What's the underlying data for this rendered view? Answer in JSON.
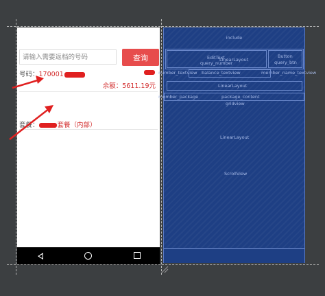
{
  "colors": {
    "accent": "#e74c4c",
    "value_red": "#d22d2d",
    "blueprint_bg": "#1e3f84",
    "canvas_bg": "#3c3f41"
  },
  "phone": {
    "search": {
      "placeholder": "请输入需要返档的号码",
      "query_button": "查询"
    },
    "number_row": {
      "label": "号码：",
      "value": "170001"
    },
    "balance_row": {
      "text": "余额：5611.19元"
    },
    "package_row": {
      "label": "套餐：",
      "value": "套餐（内部）"
    },
    "navbar": {
      "back_icon": "triangle-back-icon",
      "home_icon": "circle-home-icon",
      "recent_icon": "square-recent-icon"
    }
  },
  "blueprint": {
    "include": "include",
    "linear_layout_top": "LinearLayout",
    "edit_text": "EditText",
    "edit_text_id": "query_number",
    "button": "Button",
    "button_id": "query_btn",
    "number_textview": "number_textview",
    "balance_textview": "balance_textview",
    "member_name_textview": "member_name_textview",
    "member_package": "member_package",
    "package_content": "package_content",
    "gridview": "gridview",
    "linear_layout_mid": "LinearLayout",
    "linear_layout_main": "LinearLayout",
    "scroll_view": "ScrollView"
  }
}
